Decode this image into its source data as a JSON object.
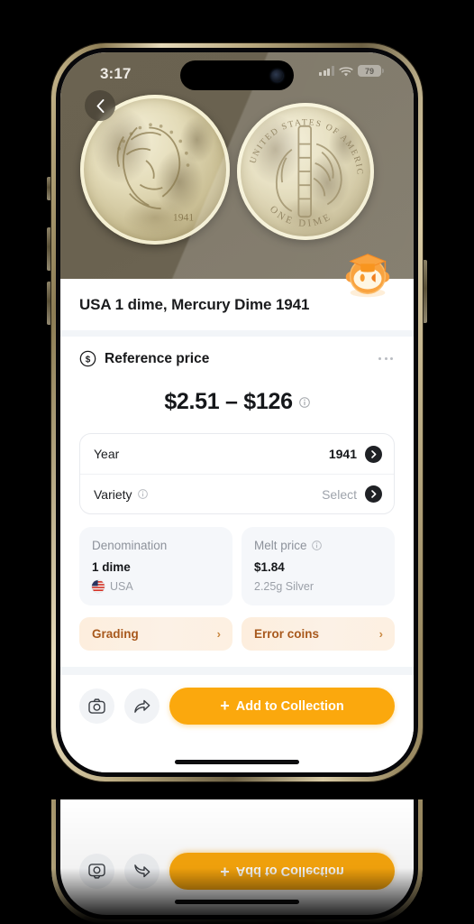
{
  "status_bar": {
    "time": "3:17",
    "signal_icon": "cellular-bars-icon",
    "wifi_icon": "wifi-icon",
    "battery_level": "79"
  },
  "hero": {
    "back_icon": "chevron-left-icon",
    "obverse_alt": "Mercury dime obverse 1941",
    "reverse_alt": "Mercury dime reverse, United States of America One Dime",
    "reverse_legend_top": "UNITED STATES OF AMERICA",
    "reverse_legend_bottom": "ONE DIME",
    "obverse_date": "1941"
  },
  "page": {
    "title": "USA 1 dime, Mercury Dime 1941"
  },
  "reference_price": {
    "icon": "dollar-circle-icon",
    "heading": "Reference price",
    "more_icon": "ellipsis-icon",
    "price_range": "$2.51 – $126",
    "price_info_icon": "info-circle-icon",
    "rows": [
      {
        "label": "Year",
        "value": "1941",
        "has_info": false,
        "chevron_icon": "chevron-right-icon"
      },
      {
        "label": "Variety",
        "value": "Select",
        "has_info": true,
        "info_icon": "info-circle-icon",
        "chevron_icon": "chevron-right-icon"
      }
    ]
  },
  "stats": [
    {
      "heading": "Denomination",
      "has_info": false,
      "value": "1 dime",
      "sub": "USA",
      "sub_icon": "usa-flag-icon"
    },
    {
      "heading": "Melt price",
      "has_info": true,
      "info_icon": "info-circle-icon",
      "value": "$1.84",
      "sub": "2.25g Silver"
    }
  ],
  "link_buttons": [
    {
      "label": "Grading",
      "chevron": "›",
      "chevron_icon": "chevron-right-icon"
    },
    {
      "label": "Error coins",
      "chevron": "›",
      "chevron_icon": "chevron-right-icon"
    }
  ],
  "mascot": {
    "icon": "graduate-mascot-icon"
  },
  "bottom_bar": {
    "camera_icon": "camera-icon",
    "share_icon": "share-arrow-icon",
    "cta_plus": "+",
    "cta_label": "Add to Collection"
  },
  "colors": {
    "accent_orange": "#fba80d",
    "link_button_text": "#a8591d",
    "link_button_bg": "#fdeedd",
    "card_bg": "#f5f7fa",
    "text_primary": "#15171a",
    "text_muted": "#9ba0a8",
    "hero_bg": "#6b6351"
  }
}
